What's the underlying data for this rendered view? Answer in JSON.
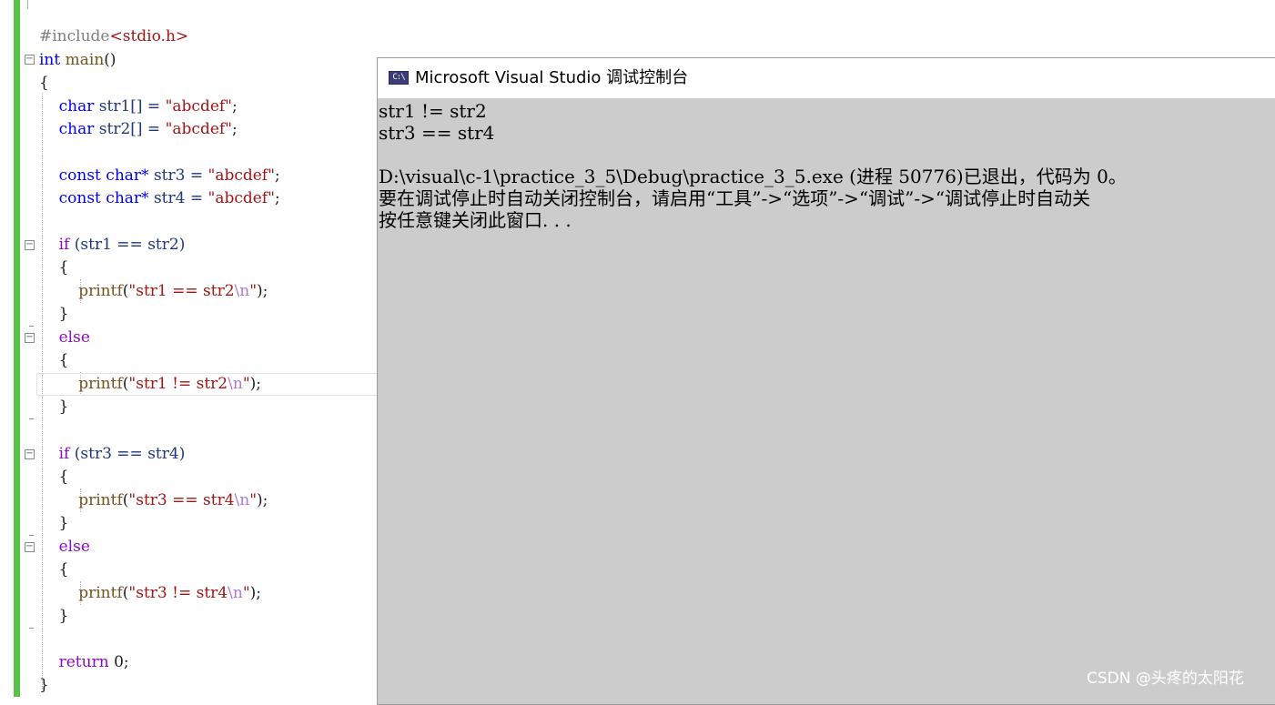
{
  "editor": {
    "lines": {
      "include_directive": "#include",
      "include_header": "<stdio.h>",
      "int_kw": "int",
      "main_fn": "main",
      "main_parens": "()",
      "brace_open_main": "{",
      "char_kw": "char",
      "str1_decl": "str1[] = ",
      "str2_decl": "str2[] = ",
      "str_abcdef": "\"abcdef\"",
      "semicolon": ";",
      "const_kw": "const",
      "char_ptr": "char*",
      "str3_decl": "str3 = ",
      "str4_decl": "str4 = ",
      "if_kw": "if",
      "cond1": "(str1 == str2)",
      "cond2": "(str3 == str4)",
      "brace_open": "{",
      "brace_close": "}",
      "printf_fn": "printf",
      "paren_open": "(",
      "paren_close_semi": ");",
      "q": "\"",
      "msg_eq12": "str1 == str2",
      "msg_ne12": "str1 != str2",
      "msg_eq34": "str3 == str4",
      "msg_ne34": "str3 != str4",
      "escape_n": "\\n",
      "else_kw": "else",
      "return_kw": "return",
      "return_val": " 0;",
      "brace_close_main": "}"
    },
    "fold_marker": "−"
  },
  "console": {
    "title": "Microsoft Visual Studio 调试控制台",
    "icon_label": "C:\\",
    "output": [
      "str1 != str2",
      "str3 == str4",
      "",
      "D:\\visual\\c-1\\practice_3_5\\Debug\\practice_3_5.exe (进程 50776)已退出，代码为 0。",
      "要在调试停止时自动关闭控制台，请启用“工具”->“选项”->“调试”->“调试停止时自动关",
      "按任意键关闭此窗口. . ."
    ],
    "icon": "console-app-icon"
  },
  "watermark": "CSDN @头疼的太阳花",
  "colors": {
    "keyword": "#0000ff",
    "string": "#a31515",
    "escape": "#b077d6",
    "control_keyword": "#8f08c4",
    "function": "#74531f",
    "console_bg": "#cccccc",
    "change_bar": "#57c24a"
  }
}
